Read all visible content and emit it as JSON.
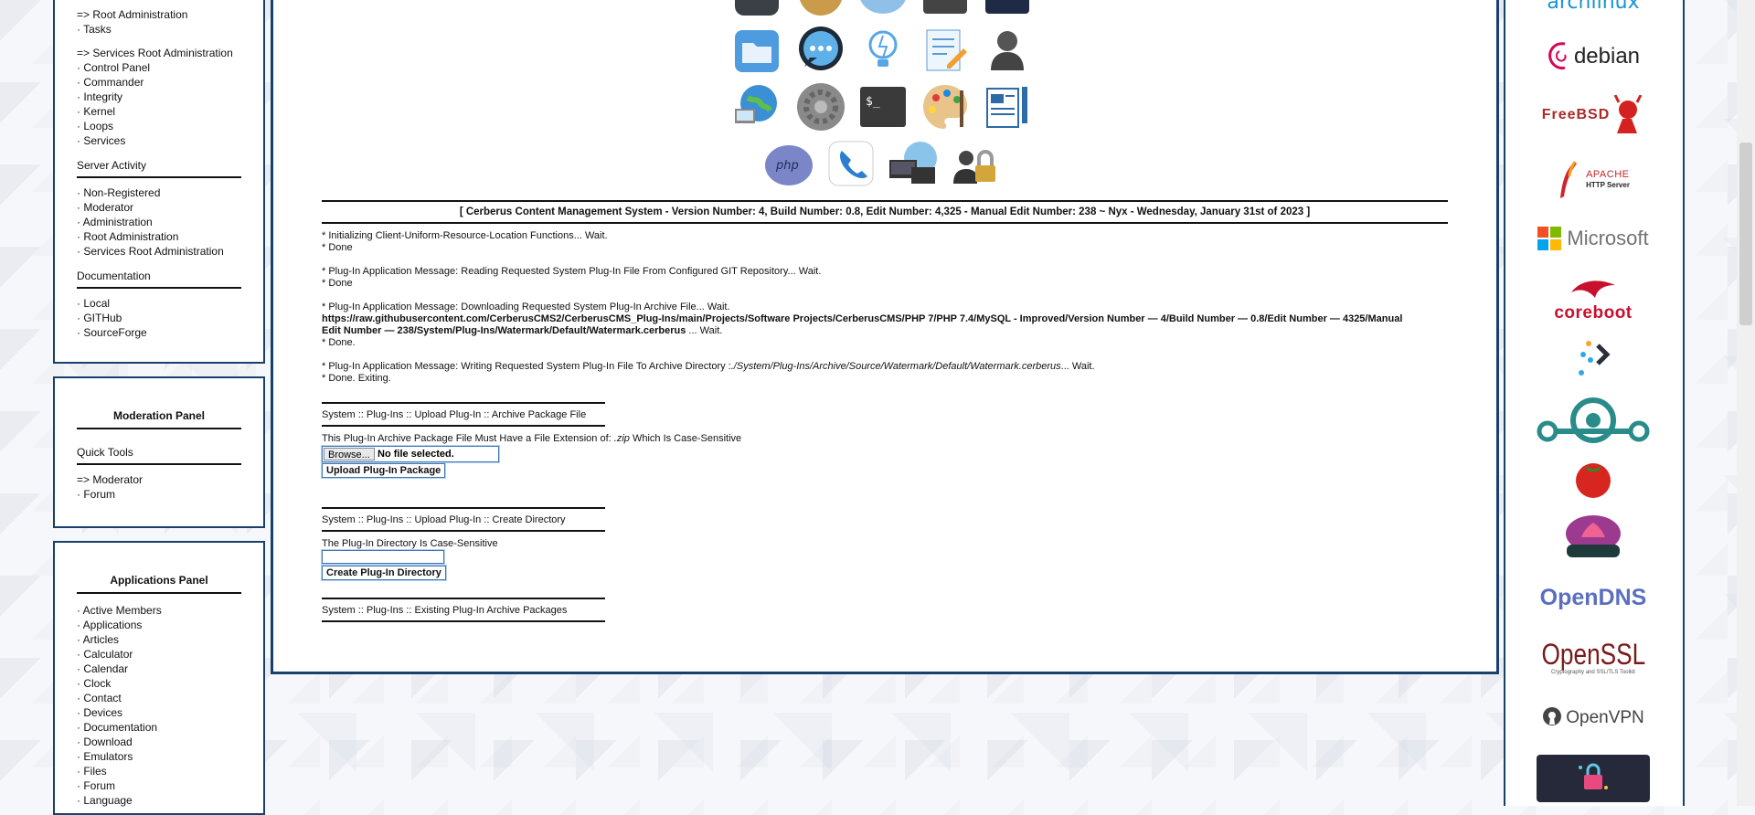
{
  "left_panel_1": {
    "root_admin": "Root Administration",
    "tasks": "Tasks",
    "services_root_admin": "Services Root Administration",
    "services_items": [
      "Control Panel",
      "Commander",
      "Integrity",
      "Kernel",
      "Loops",
      "Services"
    ],
    "server_activity_title": "Server Activity",
    "server_activity_items": [
      "Non-Registered",
      "Moderator",
      "Administration",
      "Root Administration",
      "Services Root Administration"
    ],
    "documentation_title": "Documentation",
    "documentation_items": [
      "Local",
      "GITHub",
      "SourceForge"
    ]
  },
  "moderation_panel": {
    "title": "Moderation Panel",
    "quick_tools_title": "Quick Tools",
    "moderator": "Moderator",
    "forum": "Forum"
  },
  "applications_panel": {
    "title": "Applications Panel",
    "items": [
      "Active Members",
      "Applications",
      "Articles",
      "Calculator",
      "Calendar",
      "Clock",
      "Contact",
      "Devices",
      "Documentation",
      "Download",
      "Emulators",
      "Files",
      "Forum",
      "Language"
    ]
  },
  "main": {
    "version_banner": "[ Cerberus Content Management System - Version Number: 4, Build Number: 0.8, Edit Number: 4,325 - Manual Edit Number: 238 ~ Nyx - Wednesday, January 31st of 2023 ]",
    "log": {
      "l1": "* Initializing Client-Uniform-Resource-Location Functions... Wait.",
      "l2": "* Done",
      "l3": "* Plug-In Application Message: Reading Requested System Plug-In File From Configured GIT Repository... Wait.",
      "l4": "* Done",
      "l5": "* Plug-In Application Message: Downloading Requested System Plug-In Archive File... Wait.",
      "l6": "https://raw.githubusercontent.com/CerberusCMS2/CerberusCMS_Plug-Ins/main/Projects/Software Projects/CerberusCMS/PHP 7/PHP 7.4/MySQL - Improved/Version Number — 4/Build Number — 0.8/Edit Number — 4325/Manual",
      "l7a": "Edit Number — 238/System/Plug-Ins/Watermark/Default/Watermark.cerberus",
      "l7b": " ... Wait.",
      "l8": "* Done.",
      "l9a": "* Plug-In Application Message: Writing Requested System Plug-In File To Archive Directory :",
      "l9b": "./System/Plug-Ins/Archive/Source/Watermark/Default/Watermark.cerberus",
      "l9c": "... Wait.",
      "l10": "* Done. Exiting."
    },
    "upload": {
      "title": "System :: Plug-Ins :: Upload Plug-In :: Archive Package File",
      "note_a": "This Plug-In Archive Package File Must Have a File Extension of: ",
      "note_ext": ".zip",
      "note_b": " Which Is Case-Sensitive",
      "browse": "Browse...",
      "no_file": "No file selected.",
      "submit": "Upload Plug-In Package"
    },
    "create_dir": {
      "title": "System :: Plug-Ins :: Upload Plug-In :: Create Directory",
      "note": "The Plug-In Directory Is Case-Sensitive",
      "input_value": "",
      "submit": "Create Plug-In Directory"
    },
    "existing": {
      "title": "System :: Plug-Ins :: Existing Plug-In Archive Packages"
    }
  },
  "right_logos": {
    "arch": "archlinux",
    "debian": "debian",
    "freebsd": "FreeBSD",
    "apache_a": "APACHE",
    "apache_b": "HTTP Server",
    "microsoft": "Microsoft",
    "coreboot": "coreboot",
    "opendns": "OpenDNS",
    "openssl": "OpenSSL",
    "openssl_sub": "Cryptography and SSL/TLS Toolkit",
    "openvpn": "OpenVPN"
  },
  "colors": {
    "frame_border": "#17406b",
    "button_border": "#3b78b8",
    "microsoft_red": "#f25022",
    "microsoft_green": "#7fba00",
    "microsoft_blue": "#00a4ef",
    "microsoft_yellow": "#ffb900",
    "coreboot_red": "#c8102e",
    "opendns_blue": "#5a6fbf"
  }
}
